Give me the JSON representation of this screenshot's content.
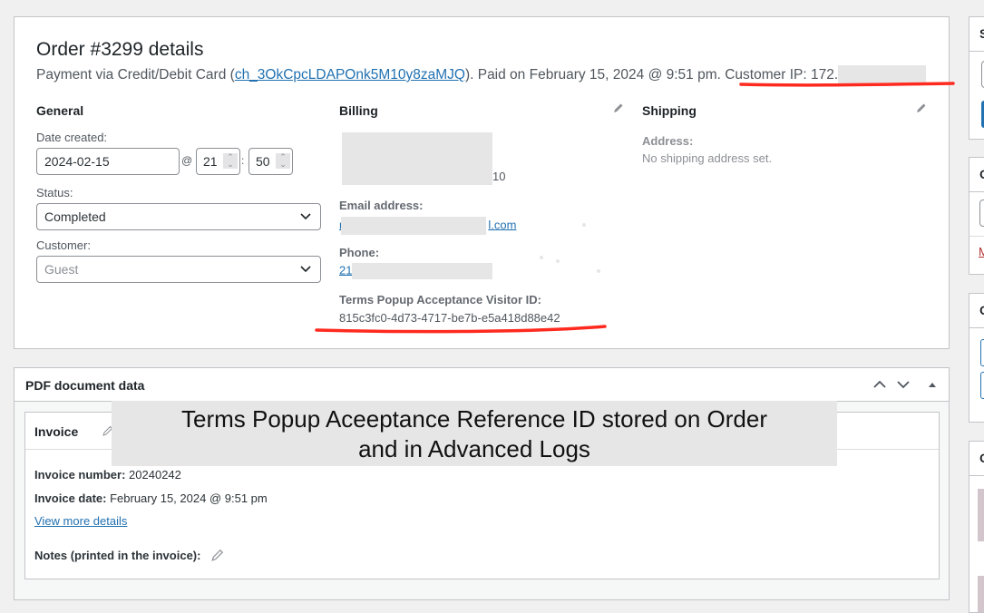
{
  "order": {
    "title": "Order #3299 details",
    "payment_prefix": "Payment via Credit/Debit Card (",
    "transaction_id": "ch_3OkCpcLDAPOnk5M10y8zaMJQ",
    "payment_suffix": "). Paid on February 15, 2024 @ 9:51 pm. ",
    "customer_ip_label": "Customer IP: 172."
  },
  "general": {
    "heading": "General",
    "date_created_label": "Date created:",
    "date_value": "2024-02-15",
    "at_symbol": "@",
    "hour_value": "21",
    "time_separator": ":",
    "minute_value": "50",
    "status_label": "Status:",
    "status_value": "Completed",
    "customer_label": "Customer:",
    "customer_value": "Guest"
  },
  "billing": {
    "heading": "Billing",
    "address_visible_tail": "10",
    "email_label": "Email address:",
    "email_visible_start": "r",
    "email_visible_end": "l.com",
    "phone_label": "Phone:",
    "phone_visible": "21",
    "visitor_id_label": "Terms Popup Acceptance Visitor ID:",
    "visitor_id_value": "815c3fc0-4d73-4717-be7b-e5a418d88e42"
  },
  "shipping": {
    "heading": "Shipping",
    "address_label": "Address:",
    "address_value": "No shipping address set."
  },
  "pdf": {
    "title": "PDF document data",
    "invoice_title": "Invoice",
    "invoice_number_label": "Invoice number:",
    "invoice_number_value": "20240242",
    "invoice_date_label": "Invoice date:",
    "invoice_date_value": "February 15, 2024 @ 9:51 pm",
    "view_more_link": "View more details",
    "notes_label": "Notes (printed in the invoice):"
  },
  "annotation": {
    "line1": "Terms Popup Aceeptance Reference ID stored on Order",
    "line2": "and in Advanced Logs",
    "underline_color": "#ff2a1f"
  },
  "sidebar": {
    "box_initials": [
      "S",
      "O",
      "O",
      "O"
    ],
    "link_initial": "M"
  }
}
